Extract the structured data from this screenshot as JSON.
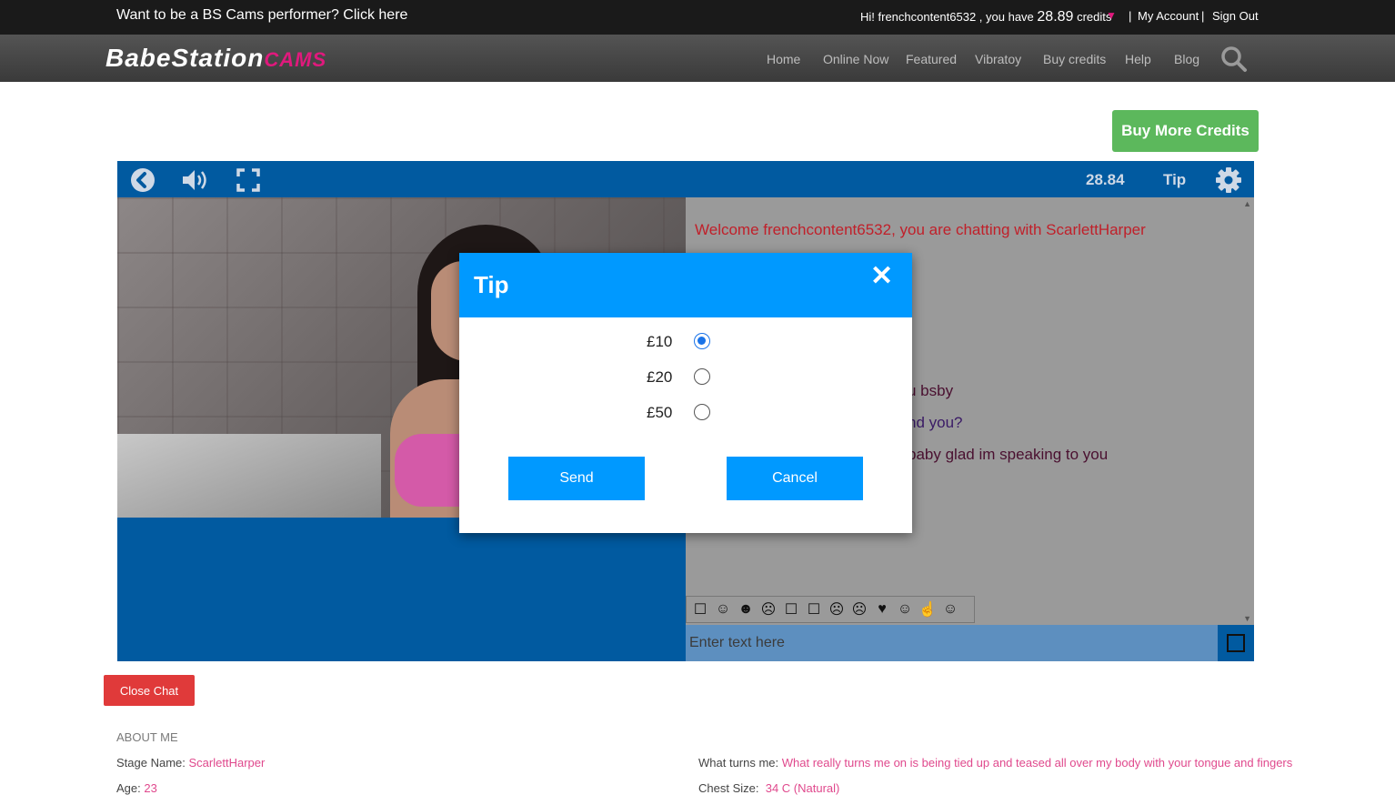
{
  "topbar": {
    "promo": "Want to be a BS Cams performer? Click here",
    "greeting_prefix": "Hi! frenchcontent6532 , you have ",
    "credits": "28.89",
    "greeting_suffix": " credits",
    "separator": "|",
    "my_account": "My Account",
    "sign_out": "Sign Out"
  },
  "logo": {
    "part1": "BabeStation",
    "part2": "CAMS"
  },
  "nav": {
    "home": "Home",
    "online_now": "Online Now",
    "featured": "Featured",
    "vibratoy": "Vibratoy",
    "buy_credits": "Buy credits",
    "help": "Help",
    "blog": "Blog"
  },
  "buy_more_credits": "Buy More Credits",
  "player": {
    "credits_readout": "28.84",
    "tip_label": "Tip"
  },
  "chat": {
    "welcome": "Welcome frenchcontent6532, you are chatting with ScarlettHarper",
    "partial_messages": [
      "u bsby",
      "nd you?",
      "baby glad im speaking to you"
    ],
    "input_placeholder": "Enter text here",
    "emojis": [
      "☐",
      "☺",
      "☻",
      "☹",
      "☐",
      "☐",
      "☹",
      "☹",
      "♥",
      "☺",
      "☝",
      "☺"
    ]
  },
  "tip_modal": {
    "title": "Tip",
    "close_glyph": "✕",
    "options": [
      "£10",
      "£20",
      "£50"
    ],
    "selected_index": 0,
    "send": "Send",
    "cancel": "Cancel"
  },
  "close_chat": "Close Chat",
  "profile": {
    "heading": "ABOUT ME",
    "stage_name_label": "Stage Name:",
    "stage_name": "ScarlettHarper",
    "age_label": "Age:",
    "age": "23",
    "turns_me_label": "What turns me:",
    "turns_me": "What really turns me on is being tied up and teased all over my body with your tongue and fingers",
    "chest_label": "Chest Size:",
    "chest": "34 C (Natural)"
  },
  "colors": {
    "brand_pink": "#e0197d",
    "player_blue": "#015aa0",
    "modal_blue": "#0099ff",
    "buy_green": "#5cb85c",
    "close_red": "#e03a3a"
  }
}
